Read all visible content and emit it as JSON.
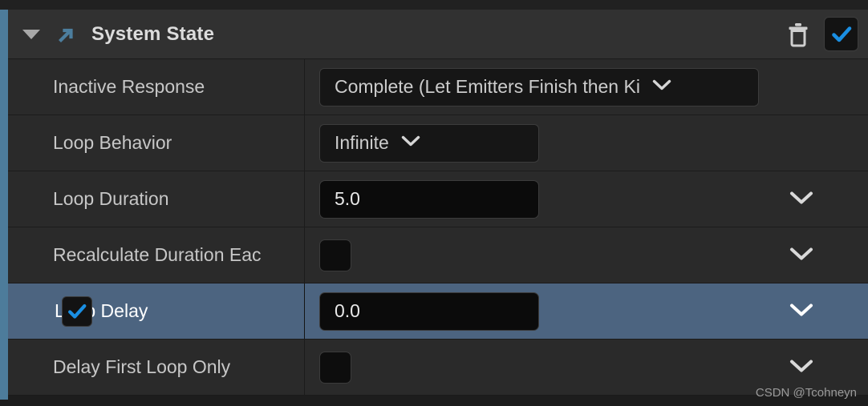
{
  "header": {
    "title": "System State",
    "collapse_icon": "triangle-down-icon",
    "category_icon": "arrow-up-right-icon",
    "delete_icon": "trash-icon",
    "enabled_checkbox": "checkbox-checked-icon",
    "enabled": true
  },
  "colors": {
    "panel_bg": "#1d1d1d",
    "header_bg": "#313131",
    "row_bg": "#2a2a2a",
    "row_selected_bg": "#4c6480",
    "accent_rail": "#4d7c9b",
    "accent_blue": "#1a8fe3",
    "label_text": "#c7c7c7",
    "value_text": "#e8e8e8",
    "input_bg": "#0b0b0b"
  },
  "rows": [
    {
      "label": "Inactive Response",
      "control": "combo",
      "value": "Complete (Let Emitters Finish then Ki",
      "checkbox": null,
      "checked": false,
      "has_chevron": false,
      "selected": false
    },
    {
      "label": "Loop Behavior",
      "control": "combo",
      "value": "Infinite",
      "checkbox": null,
      "checked": false,
      "has_chevron": false,
      "selected": false
    },
    {
      "label": "Loop Duration",
      "control": "number",
      "value": "5.0",
      "checkbox": null,
      "checked": false,
      "has_chevron": true,
      "selected": false
    },
    {
      "label": "Recalculate Duration Eac",
      "control": "checkbox",
      "value": "",
      "checkbox": null,
      "checked": false,
      "has_chevron": true,
      "selected": false
    },
    {
      "label": "Loop Delay",
      "control": "number",
      "value": "0.0",
      "checkbox": "checkbox-checked-icon",
      "checked": true,
      "has_chevron": true,
      "selected": true
    },
    {
      "label": "Delay First Loop Only",
      "control": "checkbox",
      "value": "",
      "checkbox": null,
      "checked": false,
      "has_chevron": true,
      "selected": false
    }
  ],
  "watermark": "CSDN @Tcohneyn"
}
